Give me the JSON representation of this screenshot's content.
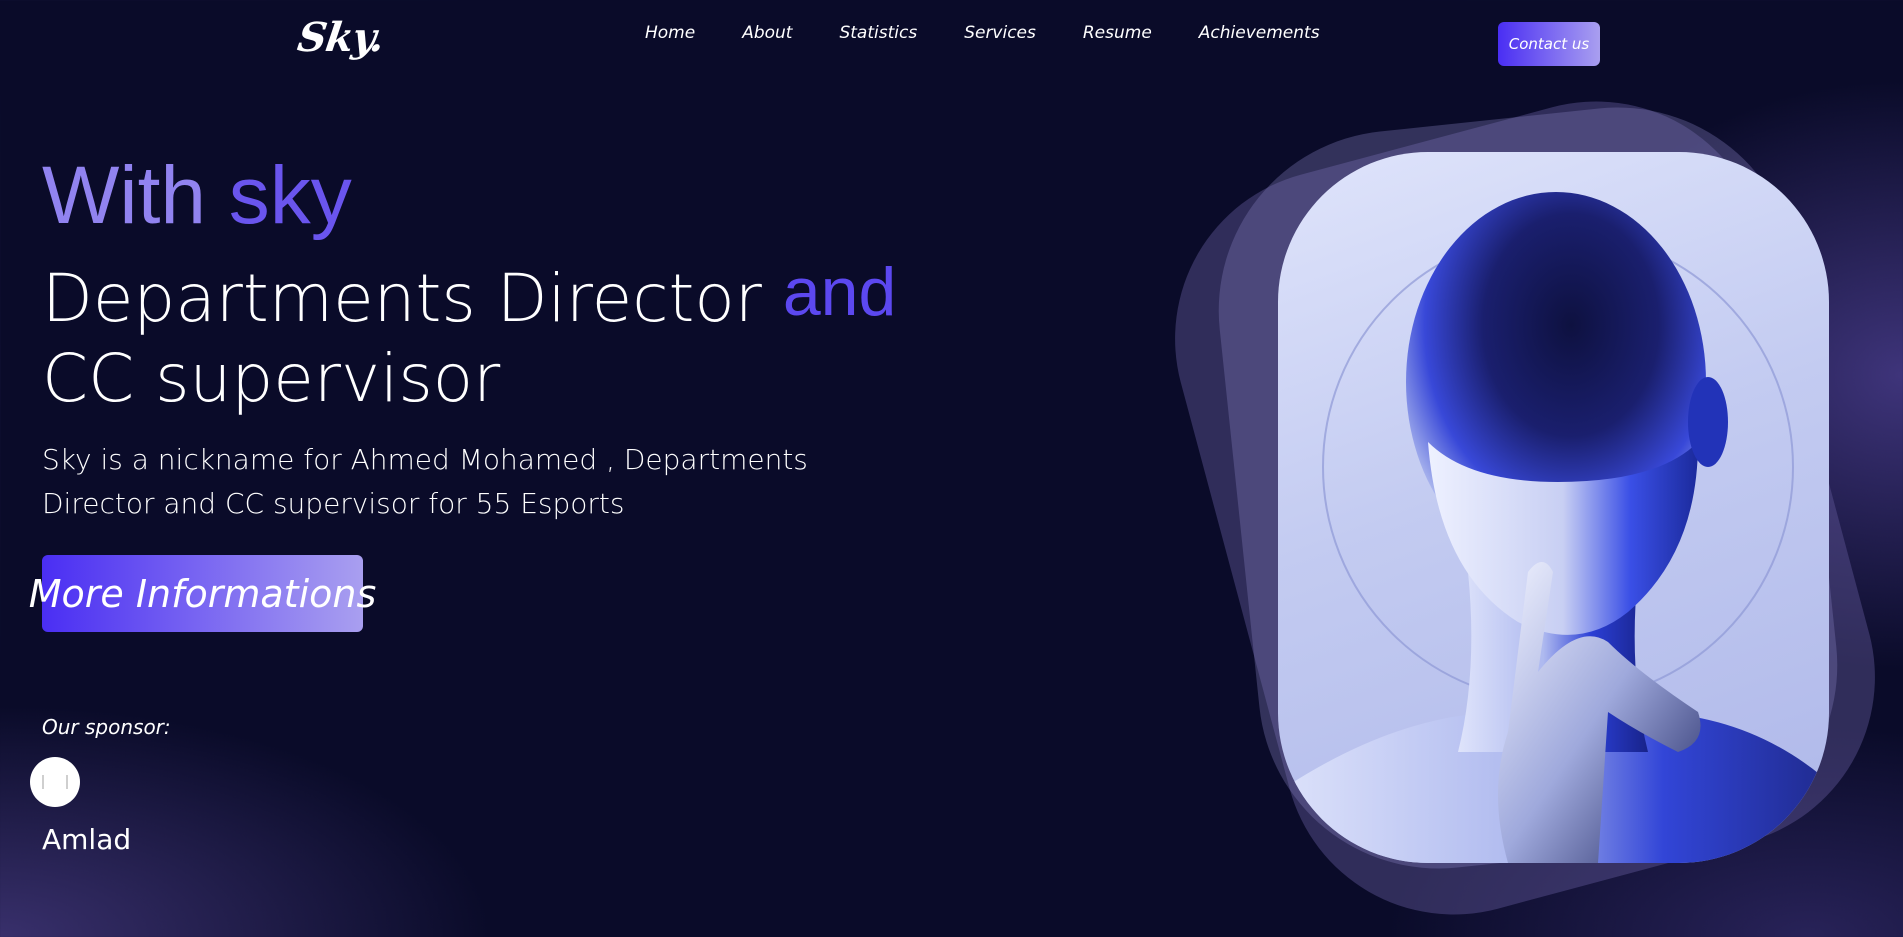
{
  "brand": {
    "logo_text": "Sky."
  },
  "nav": {
    "items": [
      "Home",
      "About",
      "Statistics",
      "Services",
      "Resume",
      "Achievements"
    ],
    "contact_label": "Contact us"
  },
  "hero": {
    "kicker_part1": "With ",
    "kicker_part2": "sky",
    "title_part1": "Departments Director ",
    "title_accent": "and",
    "title_part2": "CC supervisor",
    "description": "Sky is a nickname for Ahmed Mohamed , Departments Director and CC supervisor for 55 Esports",
    "cta_label": "More Informations"
  },
  "sponsor": {
    "label": "Our sponsor:",
    "name": "Amlad"
  },
  "colors": {
    "background": "#0a0b29",
    "accent_primary": "#4a2ef3",
    "accent_light": "#a99ff0",
    "kicker": "#9183f0"
  }
}
